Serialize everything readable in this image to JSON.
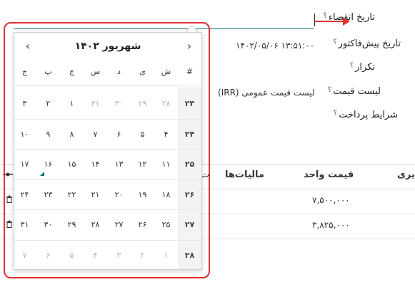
{
  "form": {
    "expiration_label": "تاریخ انقضاء",
    "quotation_date_label": "تاریخ پیش‌فاکتور",
    "quotation_date_value": "۱۴۰۲/۰۵/۰۶ ۱۳:۵۱:۰۰",
    "recurrence_label": "تکرار",
    "pricelist_label": "لیست قیمت",
    "pricelist_value": "لیست قیمت عمومی (IRR)",
    "payment_terms_label": "شرایط پرداخت",
    "help_mark": "؟"
  },
  "table": {
    "col_taxes": "مالیات‌ها",
    "col_unit_price": "قیمت واحد",
    "col_partial_right": "یری",
    "rows": [
      {
        "unit_price": "۷,۵۰۰,۰۰۰"
      },
      {
        "unit_price": "۳,۸۲۵,۰۰۰"
      }
    ]
  },
  "datepicker": {
    "month_title": "شهریور ۱۴۰۲",
    "prev_icon": "chevron-left-icon",
    "next_icon": "chevron-right-icon",
    "week_header": "#",
    "weekdays": [
      "ش",
      "ی",
      "د",
      "س",
      "چ",
      "پ",
      "ج"
    ],
    "weeks": [
      {
        "wk": "۲۳",
        "days": [
          {
            "d": "۲۸",
            "m": true
          },
          {
            "d": "۲۹",
            "m": true
          },
          {
            "d": "۳۰",
            "m": true
          },
          {
            "d": "۳۱",
            "m": true
          },
          {
            "d": "۱",
            "m": false
          },
          {
            "d": "۲",
            "m": false
          },
          {
            "d": "۳",
            "m": false
          }
        ]
      },
      {
        "wk": "۲۴",
        "days": [
          {
            "d": "۴",
            "m": false
          },
          {
            "d": "۵",
            "m": false
          },
          {
            "d": "۶",
            "m": false
          },
          {
            "d": "۷",
            "m": false
          },
          {
            "d": "۸",
            "m": false
          },
          {
            "d": "۹",
            "m": false
          },
          {
            "d": "۱۰",
            "m": false
          }
        ]
      },
      {
        "wk": "۲۵",
        "days": [
          {
            "d": "۱۱",
            "m": false
          },
          {
            "d": "۱۲",
            "m": false
          },
          {
            "d": "۱۳",
            "m": false
          },
          {
            "d": "۱۴",
            "m": false
          },
          {
            "d": "۱۵",
            "m": false
          },
          {
            "d": "۱۶",
            "m": false
          },
          {
            "d": "۱۷",
            "m": false
          }
        ]
      },
      {
        "wk": "۲۶",
        "days": [
          {
            "d": "۱۸",
            "m": false
          },
          {
            "d": "۱۹",
            "m": false
          },
          {
            "d": "۲۰",
            "m": false
          },
          {
            "d": "۲۱",
            "m": false
          },
          {
            "d": "۲۲",
            "m": false
          },
          {
            "d": "۲۳",
            "m": false
          },
          {
            "d": "۲۴",
            "m": false
          }
        ]
      },
      {
        "wk": "۲۷",
        "days": [
          {
            "d": "۲۵",
            "m": false
          },
          {
            "d": "۲۶",
            "m": false
          },
          {
            "d": "۲۷",
            "m": false
          },
          {
            "d": "۲۸",
            "m": false
          },
          {
            "d": "۲۹",
            "m": false
          },
          {
            "d": "۳۰",
            "m": false
          },
          {
            "d": "۳۱",
            "m": false
          }
        ]
      },
      {
        "wk": "۲۸",
        "days": [
          {
            "d": "۱",
            "m": true
          },
          {
            "d": "۲",
            "m": true
          },
          {
            "d": "۳",
            "m": true
          },
          {
            "d": "۴",
            "m": true
          },
          {
            "d": "۵",
            "m": true
          },
          {
            "d": "۶",
            "m": true
          },
          {
            "d": "۷",
            "m": true
          }
        ]
      }
    ],
    "today": "۱۶"
  },
  "colors": {
    "accent": "#0e6e73",
    "annotation": "#e03131"
  }
}
